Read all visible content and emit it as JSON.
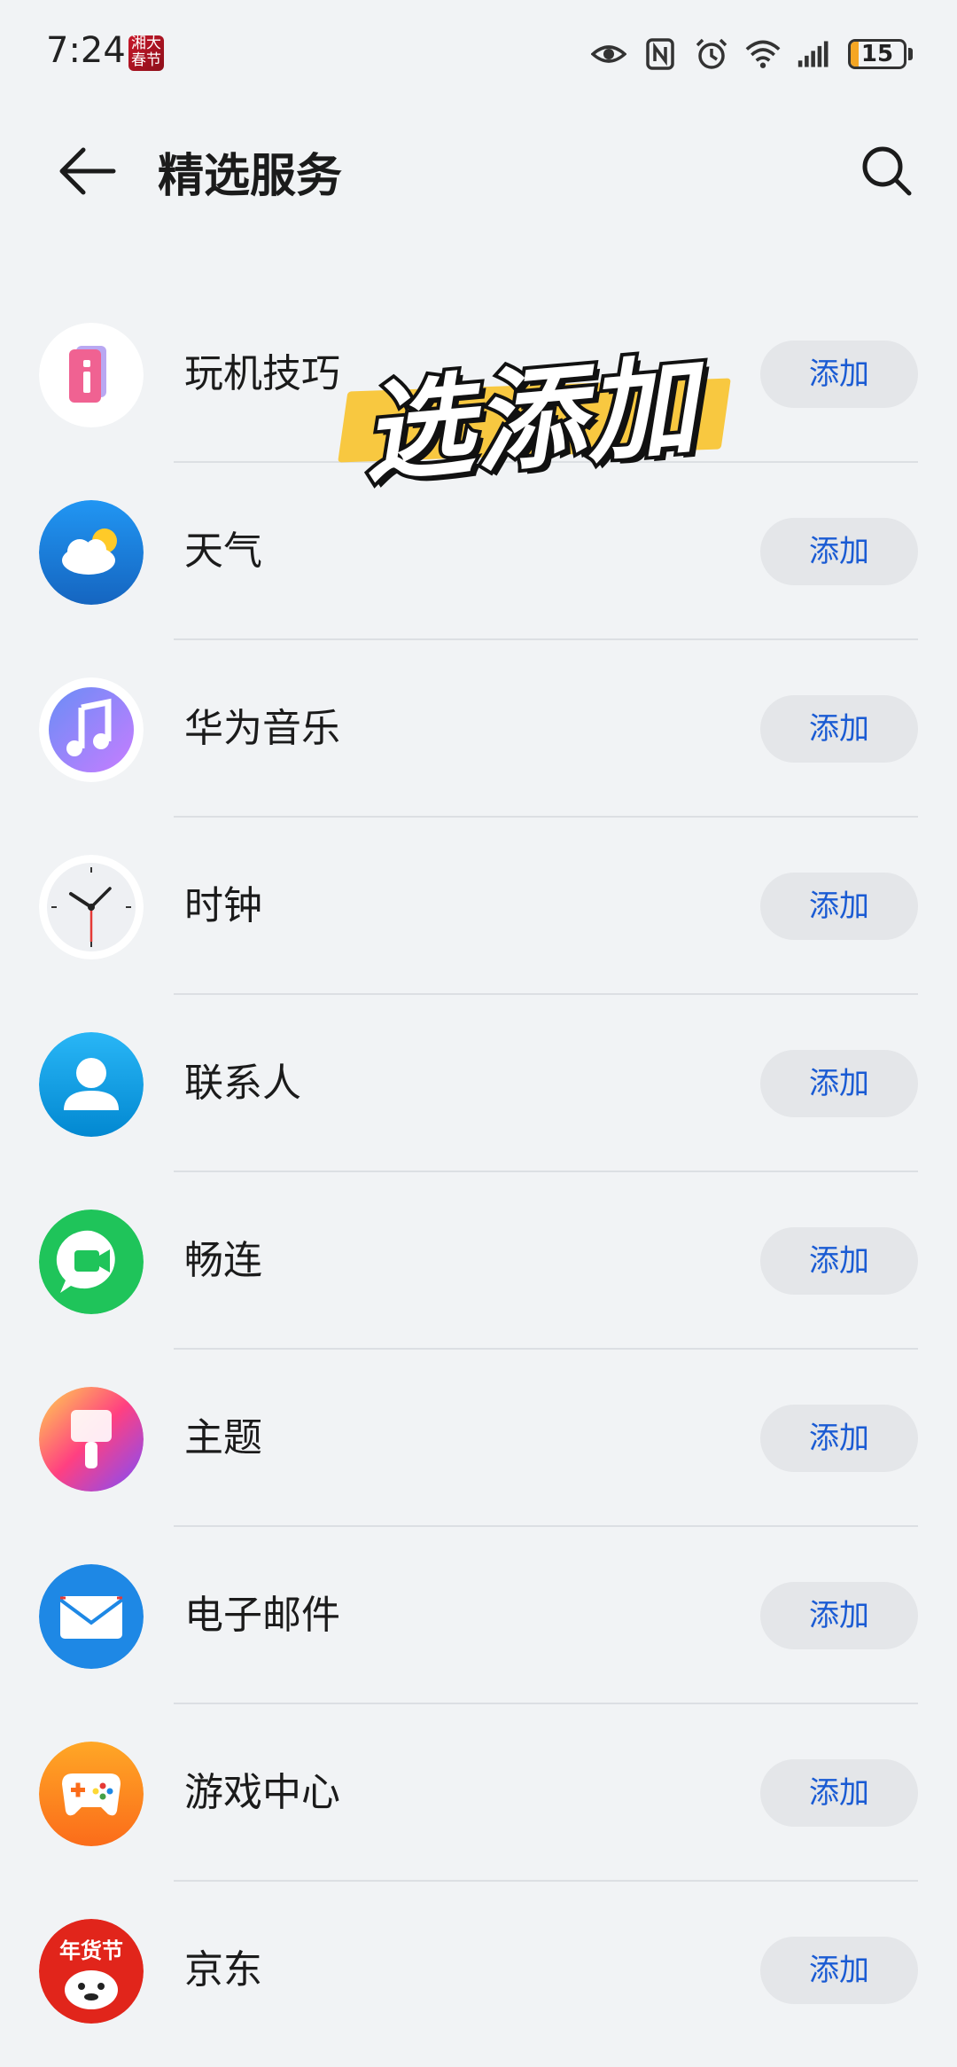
{
  "status_bar": {
    "time": "7:24",
    "notification_app_text": "湘大\n春节",
    "battery_level": "15",
    "icons": [
      "eye-icon",
      "nfc-icon",
      "alarm-icon",
      "wifi-icon",
      "signal-icon",
      "battery-icon"
    ]
  },
  "header": {
    "title": "精选服务",
    "back_icon": "arrow-left-icon",
    "search_icon": "search-icon"
  },
  "overlay": {
    "text": "选添加",
    "highlight_color": "#f8c840"
  },
  "colors": {
    "accent": "#1a5bd3",
    "button_bg": "#e4e6e9",
    "page_bg": "#f1f3f5"
  },
  "services": [
    {
      "name": "玩机技巧",
      "button": "添加",
      "icon": "tips-icon"
    },
    {
      "name": "天气",
      "button": "添加",
      "icon": "weather-icon"
    },
    {
      "name": "华为音乐",
      "button": "添加",
      "icon": "music-icon"
    },
    {
      "name": "时钟",
      "button": "添加",
      "icon": "clock-icon"
    },
    {
      "name": "联系人",
      "button": "添加",
      "icon": "contacts-icon"
    },
    {
      "name": "畅连",
      "button": "添加",
      "icon": "meetime-icon"
    },
    {
      "name": "主题",
      "button": "添加",
      "icon": "themes-icon"
    },
    {
      "name": "电子邮件",
      "button": "添加",
      "icon": "email-icon"
    },
    {
      "name": "游戏中心",
      "button": "添加",
      "icon": "game-center-icon"
    },
    {
      "name": "京东",
      "button": "添加",
      "icon": "jd-icon",
      "icon_badge": "年货节"
    }
  ]
}
